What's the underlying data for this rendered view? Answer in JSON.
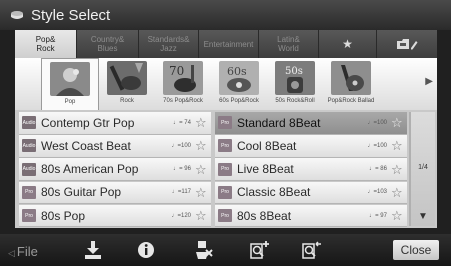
{
  "window": {
    "title": "Style Select"
  },
  "category_tabs": [
    {
      "label_line1": "Pop&",
      "label_line2": "Rock",
      "active": true
    },
    {
      "label_line1": "Country&",
      "label_line2": "Blues",
      "active": false
    },
    {
      "label_line1": "Standards&",
      "label_line2": "Jazz",
      "active": false
    },
    {
      "label_line1": "Entertainment",
      "label_line2": "",
      "active": false
    },
    {
      "label_line1": "Latin&",
      "label_line2": "World",
      "active": false
    },
    {
      "label_line1": "★",
      "label_line2": "",
      "active": false,
      "icon": "star-icon"
    },
    {
      "label_line1": "",
      "label_line2": "",
      "active": false,
      "icon": "user-folder-edit-icon"
    }
  ],
  "subcategories": [
    {
      "label": "Pop",
      "active": true
    },
    {
      "label": "Rock",
      "active": false
    },
    {
      "label": "70s Pop&Rock",
      "active": false
    },
    {
      "label": "60s Pop&Rock",
      "active": false
    },
    {
      "label": "50s Rock&Roll",
      "active": false
    },
    {
      "label": "Pop&Rock Ballad",
      "active": false
    }
  ],
  "styles_left": [
    {
      "badge": "Audio",
      "name": "Contemp Gtr Pop",
      "tempo": "♩= 74"
    },
    {
      "badge": "Audio",
      "name": "West Coast Beat",
      "tempo": "♩=100"
    },
    {
      "badge": "Audio",
      "name": "80s American Pop",
      "tempo": "♩= 96"
    },
    {
      "badge": "Pro",
      "name": "80s Guitar Pop",
      "tempo": "♩=117"
    },
    {
      "badge": "Pro",
      "name": "80s Pop",
      "tempo": "♩=120"
    }
  ],
  "styles_right": [
    {
      "badge": "Pro",
      "name": "Standard 8Beat",
      "tempo": "♩=100",
      "selected": true
    },
    {
      "badge": "Pro",
      "name": "Cool 8Beat",
      "tempo": "♩=100"
    },
    {
      "badge": "Pro",
      "name": "Live 8Beat",
      "tempo": "♩= 86"
    },
    {
      "badge": "Pro",
      "name": "Classic 8Beat",
      "tempo": "♩=103"
    },
    {
      "badge": "Pro",
      "name": "80s 8Beat",
      "tempo": "♩= 97"
    }
  ],
  "pager": {
    "page": "1/4"
  },
  "bottom_bar": {
    "file_label": "File",
    "close_label": "Close",
    "icons": [
      "save-icon",
      "info-icon",
      "delete-icon",
      "search-add-icon",
      "search-back-icon"
    ]
  },
  "colors": {
    "title_bar": "#3a3a3a",
    "active_tab": "#e0e0e0",
    "selected_row": "#9b9b9b",
    "badge": "#7a6e75"
  }
}
